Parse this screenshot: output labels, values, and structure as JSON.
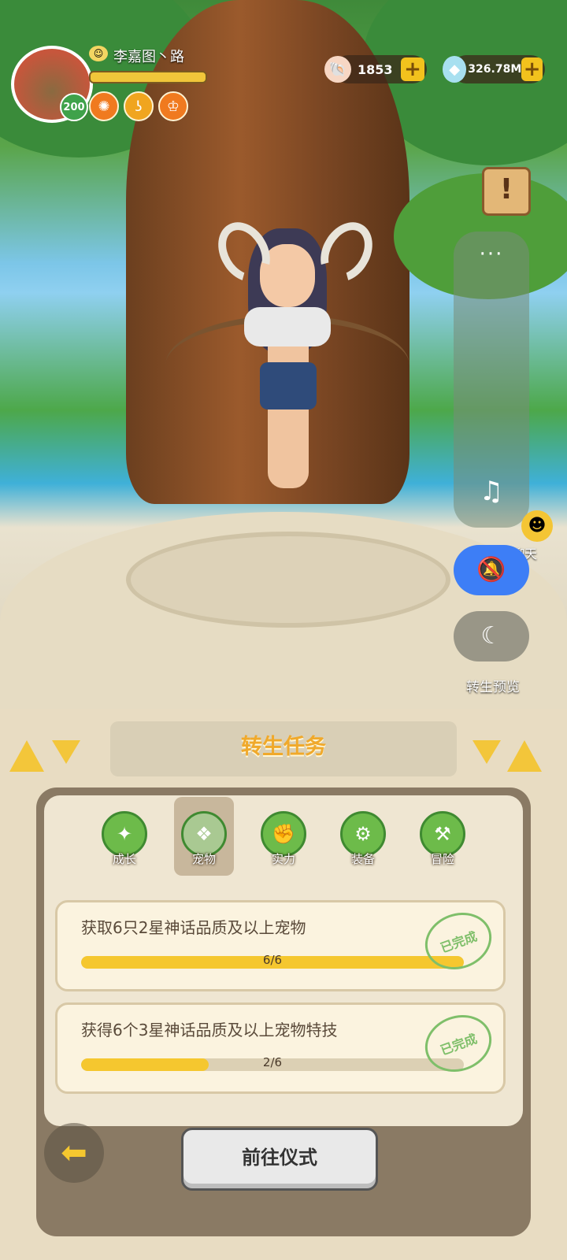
{
  "player": {
    "name": "李嘉图丶路",
    "level": "200",
    "avatar_icon": "chef-hat-avatar",
    "buff_icons": [
      "flame-badge-icon",
      "swirl-badge-icon",
      "crest-badge-icon"
    ]
  },
  "currency": {
    "shell": {
      "icon": "shell-icon",
      "value": "1853",
      "add": "+"
    },
    "crystal": {
      "icon": "crystal-icon",
      "value": "326.78M",
      "add": "+"
    }
  },
  "side": {
    "quest_icon": "!",
    "more": "···",
    "chat_label": "聊天",
    "rebirth_preview_label": "转生预览"
  },
  "panel": {
    "title": "转生任务",
    "tabs": [
      {
        "label": "成长",
        "icon": "star-icon",
        "active": false
      },
      {
        "label": "宠物",
        "icon": "pet-icon",
        "active": true
      },
      {
        "label": "实力",
        "icon": "arm-icon",
        "active": false
      },
      {
        "label": "装备",
        "icon": "gear-icon",
        "active": false
      },
      {
        "label": "冒险",
        "icon": "pickaxe-icon",
        "active": false
      }
    ],
    "tasks": [
      {
        "title": "获取6只2星神话品质及以上宠物",
        "progress": "6/6",
        "fraction": 1.0,
        "stamp": "已完成"
      },
      {
        "title": "获得6个3星神话品质及以上宠物特技",
        "progress": "2/6",
        "fraction": 0.333,
        "stamp": "已完成"
      }
    ],
    "go_button": "前往仪式"
  },
  "colors": {
    "accent_gold": "#f5c72f",
    "title_orange": "#f0a92b",
    "bell_blue": "#3d7ef6",
    "stamp_green": "#7fbf6a"
  }
}
